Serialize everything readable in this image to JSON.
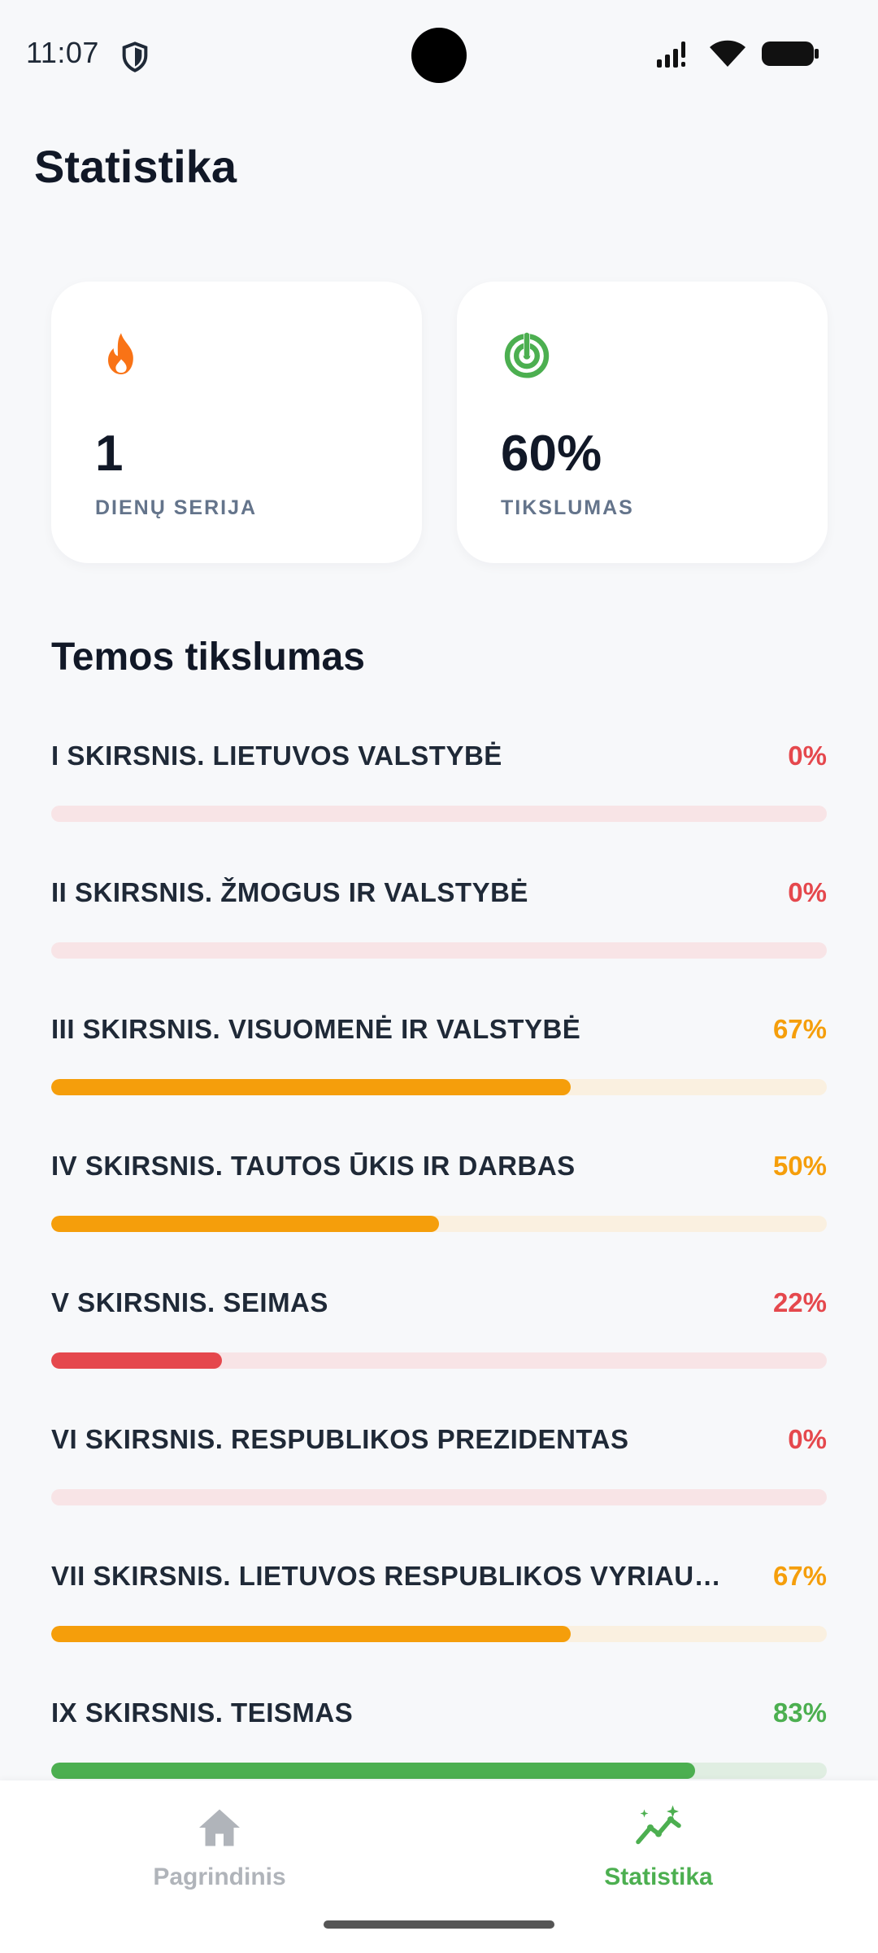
{
  "status_bar": {
    "time": "11:07"
  },
  "page": {
    "title": "Statistika"
  },
  "cards": {
    "streak": {
      "value": "1",
      "label": "DIENŲ SERIJA"
    },
    "accuracy": {
      "value": "60%",
      "label": "TIKSLUMAS"
    }
  },
  "section": {
    "title": "Temos tikslumas"
  },
  "topics": [
    {
      "name": "I SKIRSNIS. LIETUVOS VALSTYBĖ",
      "percent_text": "0%",
      "percent": 0,
      "color": "#e5484d",
      "track": "#f8e4e6"
    },
    {
      "name": "II SKIRSNIS. ŽMOGUS IR VALSTYBĖ",
      "percent_text": "0%",
      "percent": 0,
      "color": "#e5484d",
      "track": "#f8e4e6"
    },
    {
      "name": "III SKIRSNIS. VISUOMENĖ IR VALSTYBĖ",
      "percent_text": "67%",
      "percent": 67,
      "color": "#f59e0b",
      "track": "#faf0e0"
    },
    {
      "name": "IV SKIRSNIS. TAUTOS ŪKIS IR DARBAS",
      "percent_text": "50%",
      "percent": 50,
      "color": "#f59e0b",
      "track": "#faf0e0"
    },
    {
      "name": "V SKIRSNIS. SEIMAS",
      "percent_text": "22%",
      "percent": 22,
      "color": "#e5484d",
      "track": "#f8e4e6"
    },
    {
      "name": "VI SKIRSNIS. RESPUBLIKOS PREZIDENTAS",
      "percent_text": "0%",
      "percent": 0,
      "color": "#e5484d",
      "track": "#f8e4e6"
    },
    {
      "name": "VII SKIRSNIS. LIETUVOS RESPUBLIKOS VYRIAU…",
      "percent_text": "67%",
      "percent": 67,
      "color": "#f59e0b",
      "track": "#faf0e0"
    },
    {
      "name": "IX SKIRSNIS. TEISMAS",
      "percent_text": "83%",
      "percent": 83,
      "color": "#4caf50",
      "track": "#e0eee2"
    }
  ],
  "nav": {
    "home_label": "Pagrindinis",
    "stats_label": "Statistika",
    "active_color": "#4caf50",
    "inactive_color": "#b0b4ba"
  },
  "colors": {
    "streak_icon": "#f97316",
    "accuracy_icon": "#4caf50"
  }
}
